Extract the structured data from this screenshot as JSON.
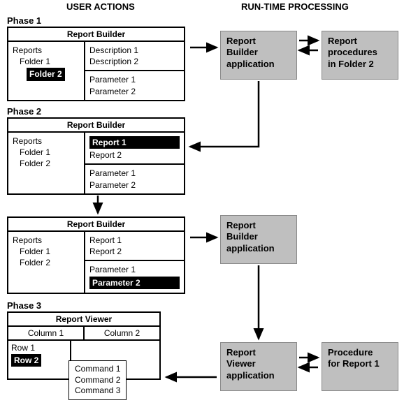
{
  "headers": {
    "user_actions": "USER ACTIONS",
    "runtime": "RUN-TIME PROCESSING"
  },
  "phases": {
    "p1": "Phase 1",
    "p2": "Phase 2",
    "p3": "Phase 3"
  },
  "panel1": {
    "title": "Report Builder",
    "left": {
      "root": "Reports",
      "f1": "Folder 1",
      "f2": "Folder 2"
    },
    "right_top": {
      "d1": "Description 1",
      "d2": "Description 2"
    },
    "right_bot": {
      "p1": "Parameter 1",
      "p2": "Parameter 2"
    }
  },
  "panel2": {
    "title": "Report Builder",
    "left": {
      "root": "Reports",
      "f1": "Folder 1",
      "f2": "Folder 2"
    },
    "right_top": {
      "r1": "Report 1",
      "r2": "Report 2"
    },
    "right_bot": {
      "p1": "Parameter 1",
      "p2": "Parameter 2"
    }
  },
  "panel3": {
    "title": "Report Builder",
    "left": {
      "root": "Reports",
      "f1": "Folder 1",
      "f2": "Folder 2"
    },
    "right_top": {
      "r1": "Report 1",
      "r2": "Report 2"
    },
    "right_bot": {
      "p1": "Parameter 1",
      "p2": "Parameter 2"
    }
  },
  "viewer": {
    "title": "Report Viewer",
    "col1": "Column 1",
    "col2": "Column 2",
    "row1": "Row 1",
    "row2": "Row 2"
  },
  "popup": {
    "c1": "Command 1",
    "c2": "Command 2",
    "c3": "Command 3"
  },
  "boxes": {
    "rb_app": "Report\nBuilder\napplication",
    "procs_f2": "Report\nprocedures\nin Folder 2",
    "rb_app2": "Report\nBuilder\n application",
    "rv_app": "Report\nViewer\napplication",
    "proc_r1": "Procedure\nfor Report 1"
  }
}
